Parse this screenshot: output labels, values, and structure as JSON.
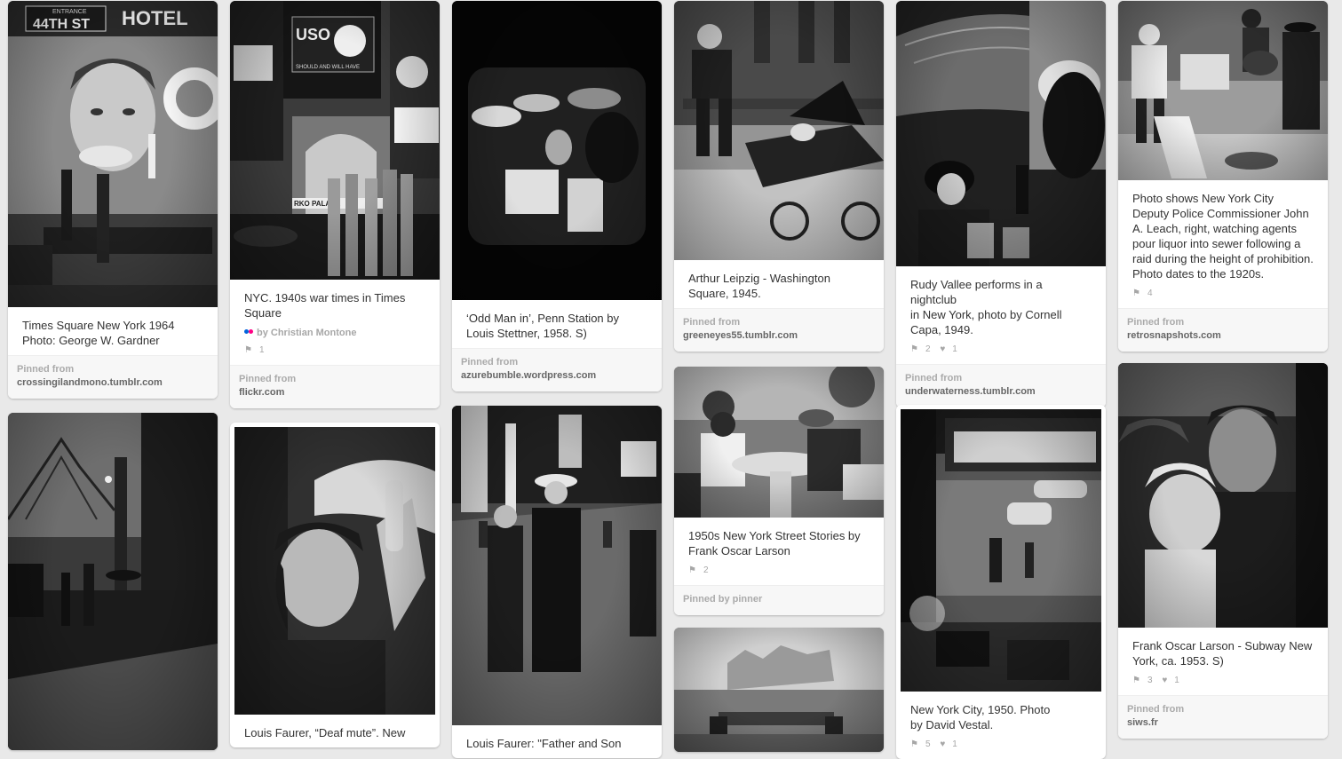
{
  "columns": [
    {
      "pins": [
        {
          "description": [
            "Times Square New York 1964",
            "Photo: George W. Gardner"
          ],
          "pinned_from_label": "Pinned from",
          "source": "crossingilandmono.tumblr.com",
          "sign_text": [
            "ENTRANCE",
            "44TH ST",
            "HOTEL"
          ]
        },
        {
          "description": []
        }
      ]
    },
    {
      "pins": [
        {
          "description": [
            "NYC. 1940s war times in Times",
            "Square"
          ],
          "via_by": "by Christian Montone",
          "repins": "1",
          "pinned_from_label": "Pinned from",
          "source": "flickr.com",
          "sign_text": [
            "USO",
            "SHOULD AND WILL HAVE",
            "RKO PALACE"
          ]
        },
        {
          "description": [
            "Louis Faurer, “Deaf mute”. New"
          ]
        }
      ]
    },
    {
      "pins": [
        {
          "description": [
            "‘Odd Man in’, Penn Station by",
            "Louis Stettner, 1958. S)"
          ],
          "pinned_from_label": "Pinned from",
          "source": "azurebumble.wordpress.com"
        },
        {
          "description": [
            "Louis Faurer: \"Father and Son"
          ]
        }
      ]
    },
    {
      "pins": [
        {
          "description": [
            "Arthur Leipzig - Washington",
            "Square, 1945."
          ],
          "pinned_from_label": "Pinned from",
          "source": "greeneyes55.tumblr.com"
        },
        {
          "description": [
            "1950s New York Street Stories by",
            "Frank Oscar Larson"
          ],
          "repins": "2",
          "pinned_by_label": "Pinned by pinner"
        },
        {
          "description": []
        }
      ]
    },
    {
      "pins": [
        {
          "description": [
            "Rudy Vallee performs in a nightclub",
            "in New York, photo by Cornell",
            "Capa, 1949."
          ],
          "repins": "2",
          "likes": "1",
          "pinned_from_label": "Pinned from",
          "source": "underwaterness.tumblr.com"
        },
        {
          "description": [
            "New York City, 1950. Photo",
            "by David Vestal."
          ],
          "repins": "5",
          "likes": "1"
        }
      ]
    },
    {
      "pins": [
        {
          "description": [
            "Photo shows New York City",
            "Deputy Police Commissioner John",
            "A. Leach, right, watching agents",
            "pour liquor into sewer following a",
            "raid during the height of prohibition.",
            "Photo dates to the 1920s."
          ],
          "repins": "4",
          "pinned_from_label": "Pinned from",
          "source": "retrosnapshots.com"
        },
        {
          "description": [
            "Frank Oscar Larson - Subway New",
            "York, ca. 1953. S)"
          ],
          "repins": "3",
          "likes": "1",
          "pinned_from_label": "Pinned from",
          "source": "siws.fr"
        }
      ]
    }
  ],
  "icons": {
    "repin": "pin-icon",
    "like": "heart-icon"
  },
  "colors": {
    "background": "#e9e9e9",
    "card": "#ffffff",
    "source_bar": "#f7f7f7"
  }
}
